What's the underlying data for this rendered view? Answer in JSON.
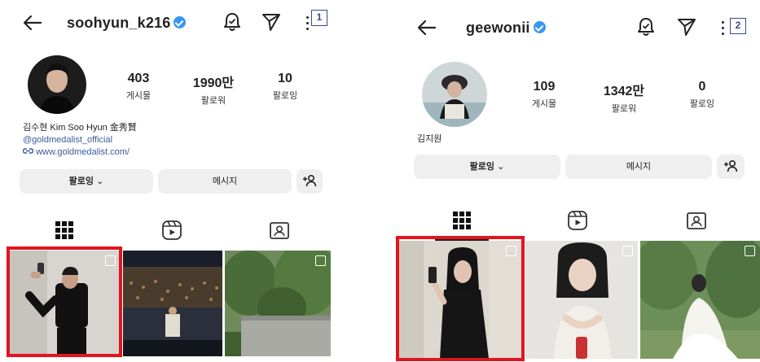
{
  "left_profile": {
    "username": "soohyun_k216",
    "menu_badge": "1",
    "stats": [
      {
        "value": "403",
        "label": "게시물"
      },
      {
        "value": "1990만",
        "label": "팔로워"
      },
      {
        "value": "10",
        "label": "팔로잉"
      }
    ],
    "bio_name": "김수현 Kim Soo Hyun 金秀賢",
    "bio_tag": "@goldmedalist_official",
    "bio_link": "www.goldmedalist.com/",
    "follow_button": "팔로잉",
    "message_button": "메시지",
    "add_person_icon": "add-person-icon"
  },
  "right_profile": {
    "username": "geewonii",
    "menu_badge": "2",
    "stats": [
      {
        "value": "109",
        "label": "게시물"
      },
      {
        "value": "1342만",
        "label": "팔로워"
      },
      {
        "value": "0",
        "label": "팔로잉"
      }
    ],
    "bio_name": "김지원",
    "follow_button": "팔로잉",
    "message_button": "메시지",
    "add_person_icon": "add-person-icon"
  },
  "colors": {
    "highlight": "#e3141e",
    "verified": "#3897f0",
    "link": "#3b5b9a"
  }
}
